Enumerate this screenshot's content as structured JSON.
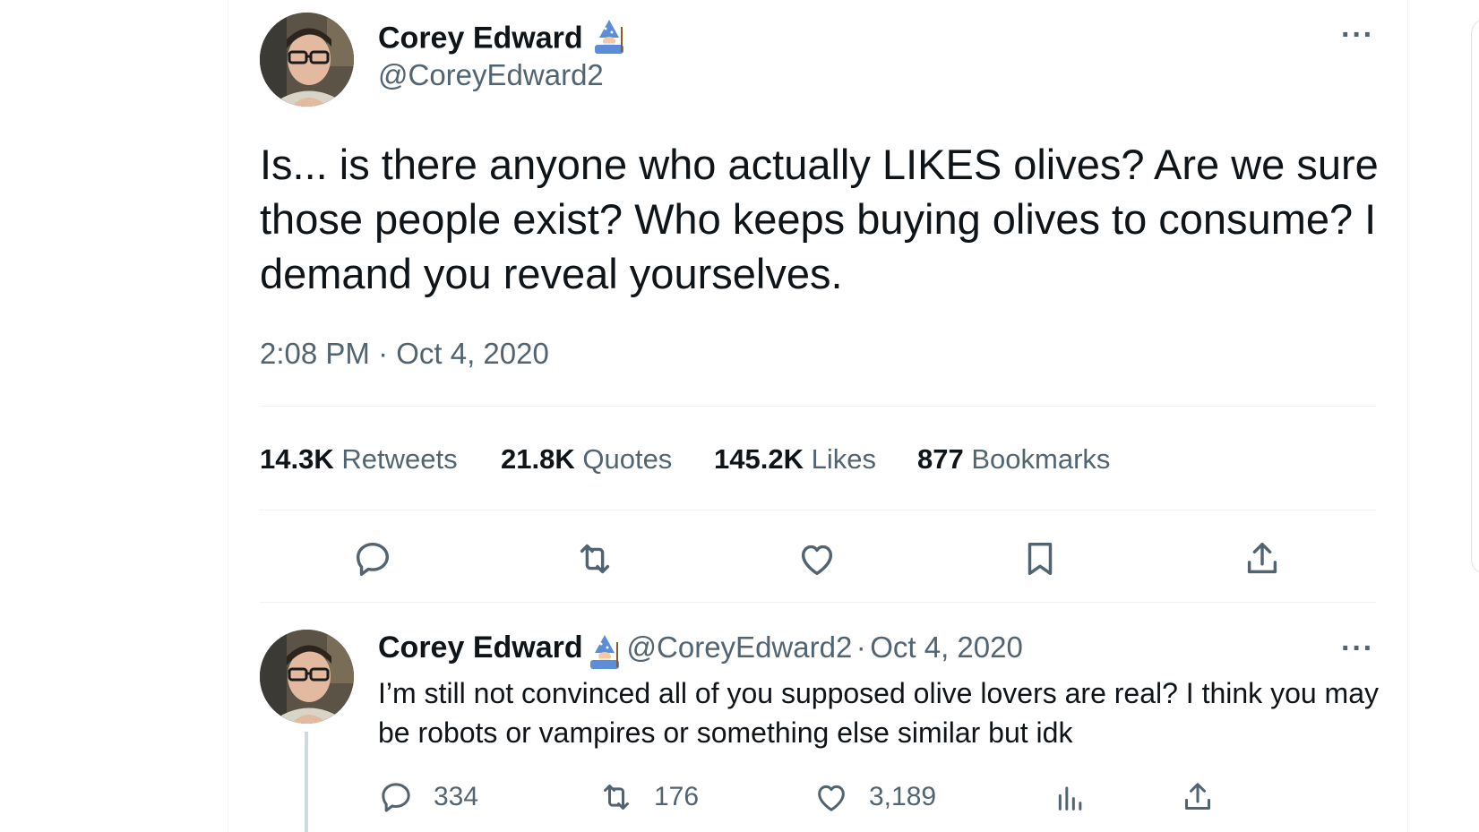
{
  "tweet": {
    "author_name": "Corey Edward",
    "author_handle": "@CoreyEdward2",
    "author_emoji": "mage-icon",
    "text": "Is... is there anyone who actually LIKES olives? Are we sure those people exist? Who keeps buying olives to consume? I demand you reveal yourselves.",
    "timestamp": "2:08 PM · Oct 4, 2020",
    "more_label": "···",
    "stats": [
      {
        "value": "14.3K",
        "label": "Retweets"
      },
      {
        "value": "21.8K",
        "label": "Quotes"
      },
      {
        "value": "145.2K",
        "label": "Likes"
      },
      {
        "value": "877",
        "label": "Bookmarks"
      }
    ],
    "actions": [
      "reply-icon",
      "retweet-icon",
      "like-icon",
      "bookmark-icon",
      "share-icon"
    ]
  },
  "reply": {
    "author_name": "Corey Edward",
    "author_handle": "@CoreyEdward2",
    "separator": "·",
    "date": "Oct 4, 2020",
    "more_label": "···",
    "text": "I’m still not convinced all of you supposed olive lovers are real? I think you may be robots or vampires or something else similar but idk",
    "replies": "334",
    "retweets": "176",
    "likes": "3,189"
  },
  "colors": {
    "text_primary": "#0f1419",
    "text_secondary": "#536471",
    "divider": "#eff3f4",
    "thread_line": "#cfd9de"
  }
}
